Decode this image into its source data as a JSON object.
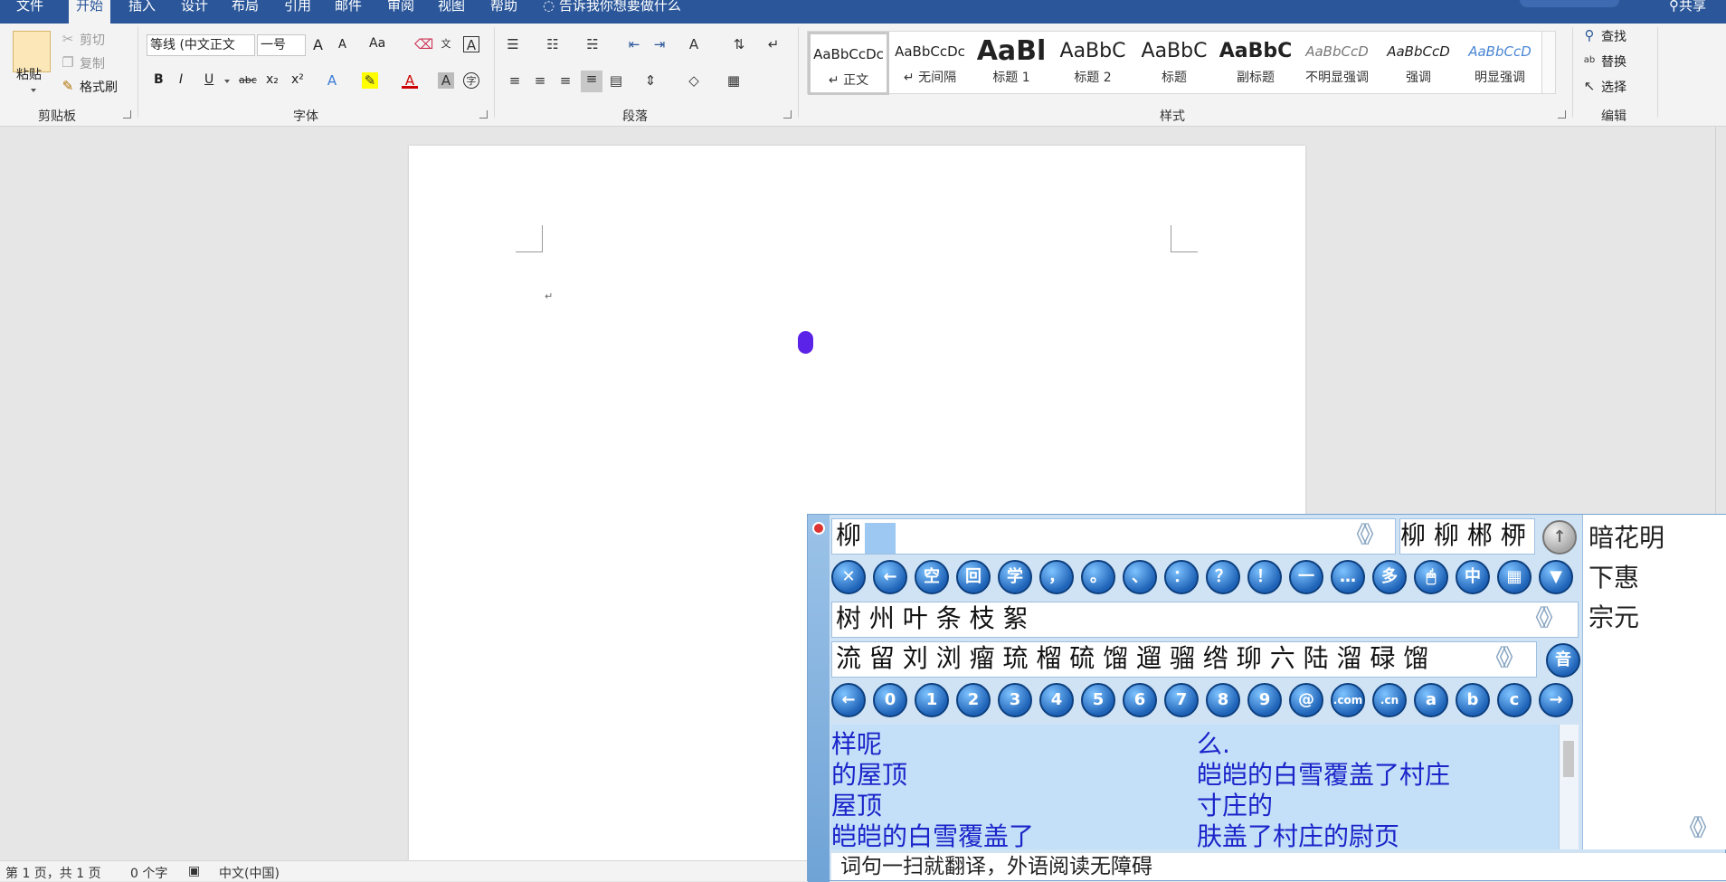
{
  "tabs": [
    "文件",
    "开始",
    "插入",
    "设计",
    "布局",
    "引用",
    "邮件",
    "审阅",
    "视图",
    "帮助"
  ],
  "tell_me": "告诉我你想要做什么",
  "share": "共享",
  "clipboard": {
    "paste": "粘贴",
    "cut": "剪切",
    "copy": "复制",
    "format_painter": "格式刷",
    "label": "剪贴板"
  },
  "font": {
    "name": "等线 (中文正文",
    "size": "一号",
    "label": "字体",
    "buttons": {
      "bold": "B",
      "italic": "I",
      "underline": "U",
      "strike": "abc",
      "sub": "x₂",
      "sup": "x²",
      "grow": "A",
      "shrink": "A",
      "case": "Aa"
    }
  },
  "paragraph": {
    "label": "段落"
  },
  "styles": {
    "label": "样式",
    "items": [
      {
        "sample": "AaBbCcDc",
        "name": "↵ 正文"
      },
      {
        "sample": "AaBbCcDc",
        "name": "↵ 无间隔"
      },
      {
        "sample": "AaBl",
        "name": "标题 1"
      },
      {
        "sample": "AaBbC",
        "name": "标题 2"
      },
      {
        "sample": "AaBbC",
        "name": "标题"
      },
      {
        "sample": "AaBbC",
        "name": "副标题"
      },
      {
        "sample": "AaBbCcD",
        "name": "不明显强调"
      },
      {
        "sample": "AaBbCcD",
        "name": "强调"
      },
      {
        "sample": "AaBbCcD",
        "name": "明显强调"
      }
    ]
  },
  "editing": {
    "find": "查找",
    "replace": "替换",
    "select": "选择",
    "label": "编辑"
  },
  "document": {
    "para_mark": "↵"
  },
  "status": {
    "page": "第 1 页，共 1 页",
    "words": "0 个字",
    "language": "中文(中国)"
  },
  "ime": {
    "input_char": "柳",
    "candidates_top": "柳 柳 郴 桺",
    "assoc_right": [
      "暗花明",
      "下惠",
      "宗元"
    ],
    "row_words": "树 州 叶 条 枝 絮",
    "row_homophones": "流 留 刘 浏 瘤 琉 榴 硫 馏 遛 骝 绺 珋 六 陆 溜 碌 馏",
    "sym_buttons": [
      "✕",
      "←",
      "空",
      "回",
      "学",
      "，",
      "。",
      "、",
      "：",
      "？",
      "！",
      "一",
      "…",
      "多",
      "🖱",
      "中",
      "▦",
      "▼"
    ],
    "num_buttons": [
      "←",
      "0",
      "1",
      "2",
      "3",
      "4",
      "5",
      "6",
      "7",
      "8",
      "9",
      "@",
      ".com",
      ".cn",
      "a",
      "b",
      "c",
      "→"
    ],
    "sound_button": "音",
    "phrases_left": [
      "样呢",
      "的屋顶",
      "屋顶",
      "皑皑的白雪覆盖了"
    ],
    "phrases_right": [
      "么.",
      "皑皑的白雪覆盖了村庄",
      "寸庄的",
      "肤盖了村庄的尉页"
    ],
    "tip": "词句一扫就翻译，外语阅读无障碍"
  }
}
